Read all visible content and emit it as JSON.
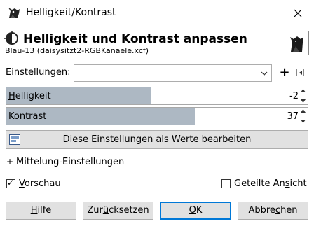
{
  "window": {
    "title": "Helligkeit/Kontrast",
    "close_glyph": "✕"
  },
  "header": {
    "title": "Helligkeit und Kontrast anpassen",
    "subtitle": "Blau-13 (daisysitzt2-RGBKanaele.xcf)"
  },
  "settings": {
    "label": "Einstellungen:",
    "value": "",
    "add_glyph": "+"
  },
  "sliders": [
    {
      "label": "Helligkeit",
      "value": "-2",
      "fill_fraction": 0.48
    },
    {
      "label": "Kontrast",
      "value": "37",
      "fill_fraction": 0.625
    }
  ],
  "edit_button": {
    "label": "Diese Einstellungen als Werte bearbeiten"
  },
  "expander": {
    "glyph": "+",
    "label": "Mittelung-Einstellungen"
  },
  "preview": {
    "label": "Vorschau",
    "checked": true
  },
  "split_view": {
    "label": "Geteilte Ansicht",
    "checked": false
  },
  "buttons": {
    "help": "Hilfe",
    "reset": "Zurücksetzen",
    "ok": "OK",
    "cancel": "Abbrechen"
  },
  "colors": {
    "slider_fill": "#adb8c3",
    "default_button_border": "#0078d7",
    "button_bg": "#e1e1e1"
  },
  "icons": {
    "title": "wilber-dog-icon",
    "header": "brightness-contrast-icon",
    "thumbnail": "layer-thumbnail",
    "edit_button": "edit-values-icon"
  }
}
